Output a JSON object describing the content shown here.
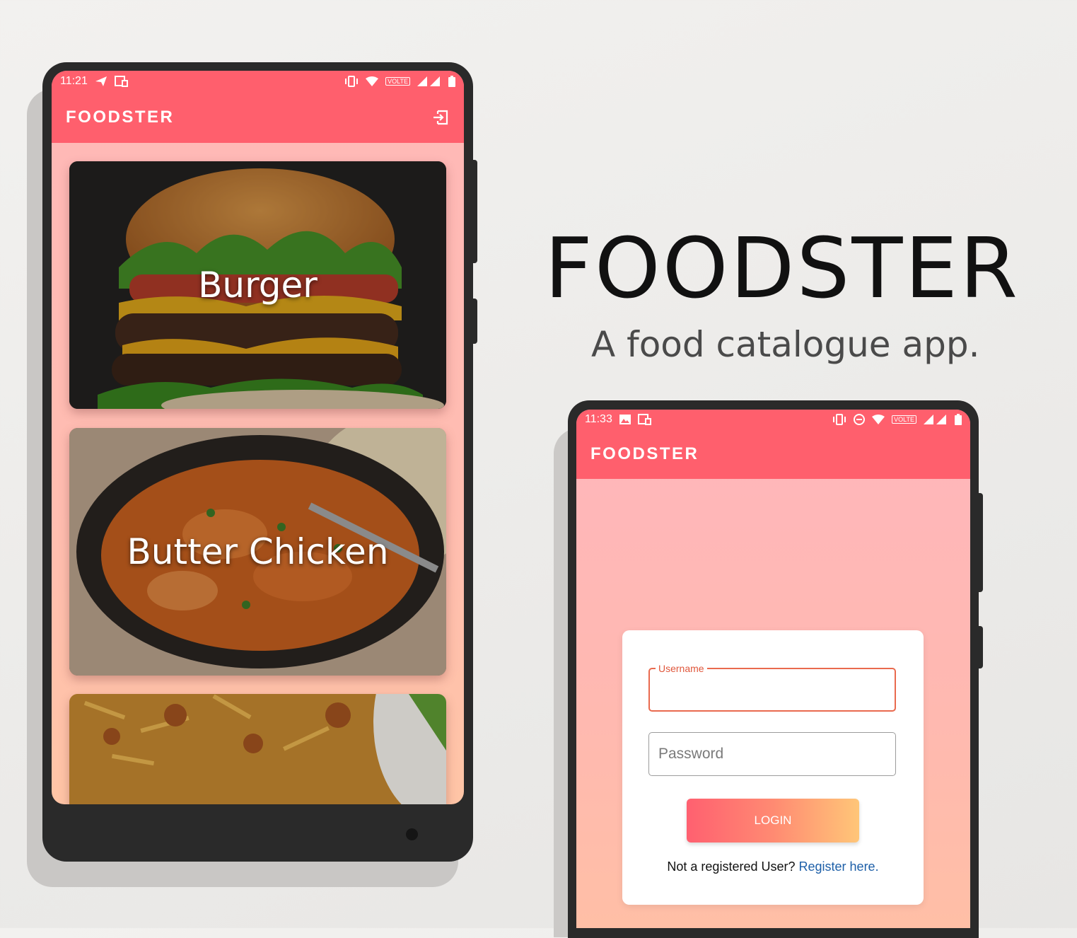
{
  "headline": {
    "title": "FOODSTER",
    "subtitle": "A food catalogue app."
  },
  "catalogue_screen": {
    "status_time": "11:21",
    "status_network": "VOLTE",
    "app_title": "FOODSTER",
    "action_icon": "login-icon",
    "cards": [
      {
        "label": "Burger"
      },
      {
        "label": "Butter Chicken"
      },
      {
        "label": ""
      }
    ]
  },
  "login_screen": {
    "status_time": "11:33",
    "status_network": "VOLTE",
    "app_title": "FOODSTER",
    "username": {
      "label": "Username",
      "value": ""
    },
    "password": {
      "placeholder": "Password",
      "value": ""
    },
    "login_label": "LOGIN",
    "register_prompt": "Not a registered User?",
    "register_link": "Register here."
  },
  "colors": {
    "primary": "#ff5f6d",
    "accent_orange": "#ffc678",
    "link": "#1d5fa8",
    "field_focus": "#e96a4e"
  }
}
